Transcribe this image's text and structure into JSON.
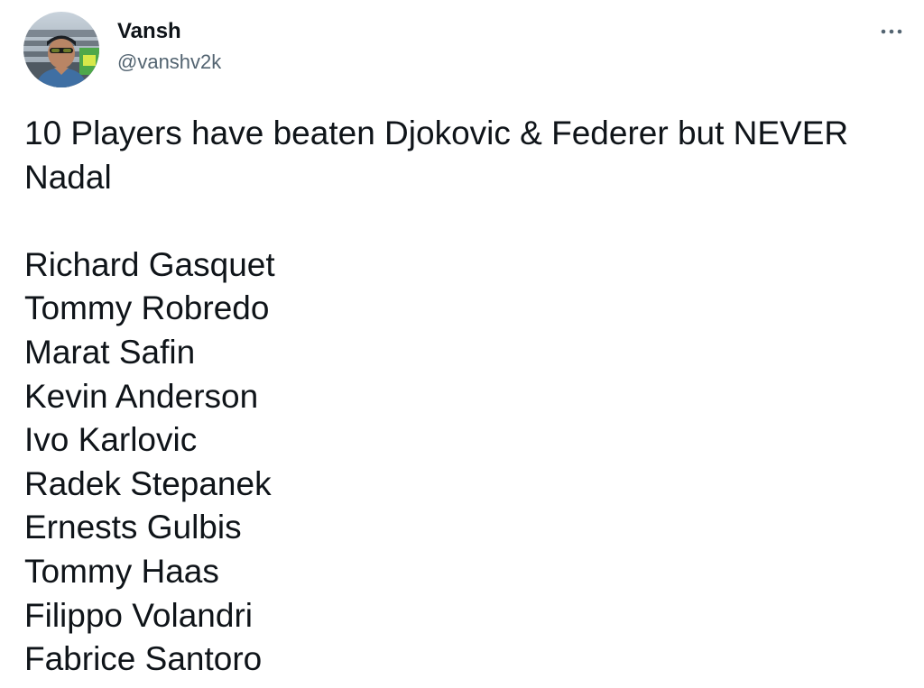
{
  "tweet": {
    "author": {
      "display_name": "Vansh",
      "handle": "@vanshv2k"
    },
    "more_icon": "more-horizontal-icon",
    "headline": "10 Players have beaten Djokovic & Federer but NEVER Nadal",
    "players": [
      "Richard Gasquet",
      "Tommy Robredo",
      "Marat Safin",
      "Kevin Anderson",
      "Ivo Karlovic",
      "Radek Stepanek",
      "Ernests Gulbis",
      "Tommy Haas",
      "Filippo Volandri",
      "Fabrice Santoro"
    ]
  },
  "colors": {
    "text_primary": "#0f1419",
    "text_secondary": "#536471",
    "background": "#ffffff"
  }
}
